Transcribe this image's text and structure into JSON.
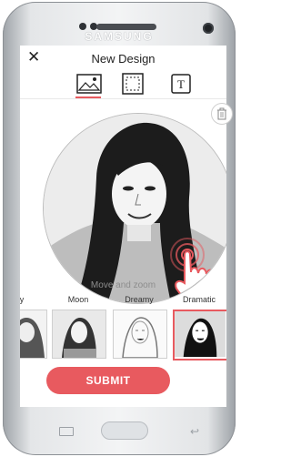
{
  "device": {
    "brand": "SAMSUNG"
  },
  "header": {
    "title": "New Design",
    "close_label": "✕"
  },
  "tabs": [
    {
      "name": "photo",
      "icon": "image-icon"
    },
    {
      "name": "frame",
      "icon": "frame-icon"
    },
    {
      "name": "text",
      "icon": "text-icon",
      "label": "T"
    }
  ],
  "editor": {
    "hint": "Move and zoom"
  },
  "filters": [
    {
      "label": "y"
    },
    {
      "label": "Moon"
    },
    {
      "label": "Dreamy"
    },
    {
      "label": "Dramatic"
    }
  ],
  "actions": {
    "submit_label": "SUBMIT"
  },
  "colors": {
    "accent": "#e85a5f"
  }
}
